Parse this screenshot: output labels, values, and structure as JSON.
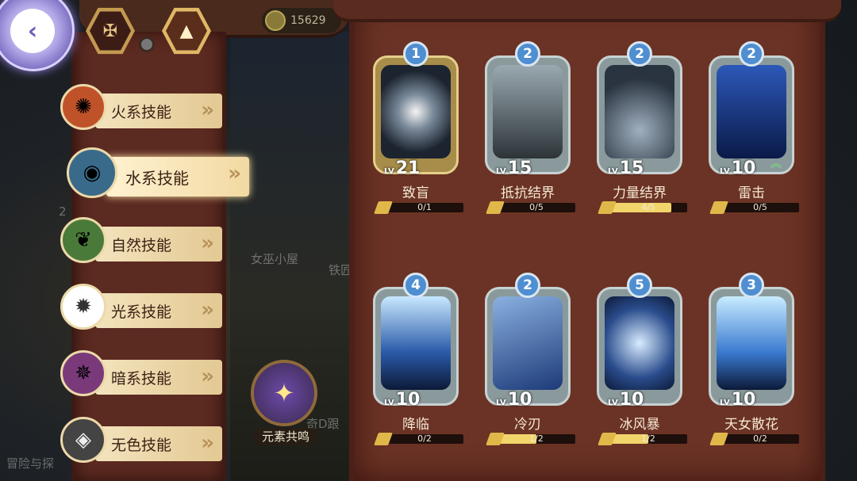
{
  "gold": "15629",
  "categories": [
    {
      "label": "火系技能",
      "icon": "fire-icon",
      "color": "#c0522a"
    },
    {
      "label": "水系技能",
      "icon": "water-icon",
      "color": "#3a6a8a"
    },
    {
      "label": "自然技能",
      "icon": "leaf-icon",
      "color": "#4a7a3a"
    },
    {
      "label": "光系技能",
      "icon": "sun-icon",
      "color": "#ffffff"
    },
    {
      "label": "暗系技能",
      "icon": "dark-swirl-icon",
      "color": "#7a3a7a"
    },
    {
      "label": "无色技能",
      "icon": "diamond-icon",
      "color": "#555555"
    }
  ],
  "active_category": "水系技能",
  "resonance_label": "元素共鸣",
  "background_labels": [
    "女巫小屋",
    "铁匠",
    "冒险与探",
    "奇D跟",
    "2"
  ],
  "skills": [
    {
      "rank": "1",
      "level": "21",
      "name": "致盲",
      "progress": "0/1",
      "fraction": 0.0,
      "gold": true
    },
    {
      "rank": "2",
      "level": "15",
      "name": "抵抗结界",
      "progress": "0/5",
      "fraction": 0.0
    },
    {
      "rank": "2",
      "level": "15",
      "name": "力量结界",
      "progress": "4/5",
      "fraction": 0.8
    },
    {
      "rank": "2",
      "level": "10",
      "name": "雷击",
      "progress": "0/5",
      "fraction": 0.0,
      "upgrade": true
    },
    {
      "rank": "4",
      "level": "10",
      "name": "降临",
      "progress": "0/2",
      "fraction": 0.0
    },
    {
      "rank": "2",
      "level": "10",
      "name": "冷刃",
      "progress": "1/2",
      "fraction": 0.5
    },
    {
      "rank": "5",
      "level": "10",
      "name": "冰风暴",
      "progress": "1/2",
      "fraction": 0.5
    },
    {
      "rank": "3",
      "level": "10",
      "name": "天女散花",
      "progress": "0/2",
      "fraction": 0.0
    }
  ]
}
